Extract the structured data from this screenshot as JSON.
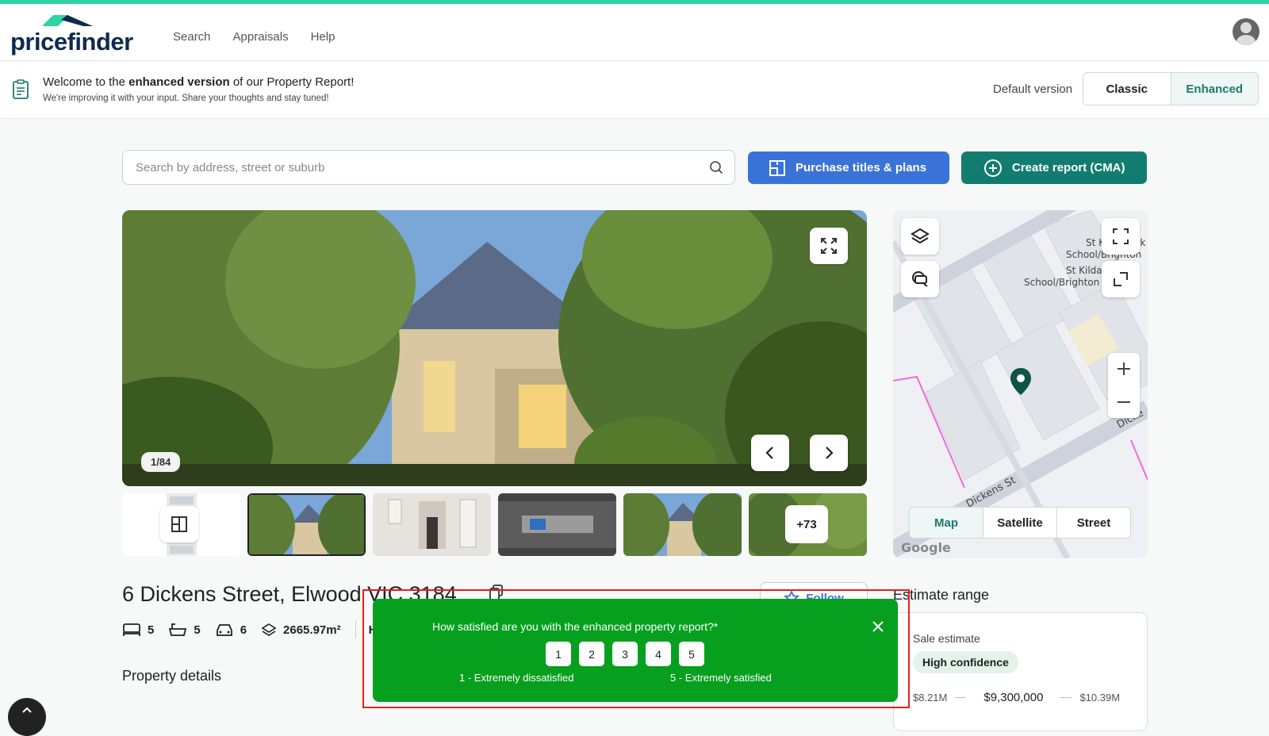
{
  "app": {
    "logo_text": "pricefinder",
    "nav": [
      "Search",
      "Appraisals",
      "Help"
    ]
  },
  "banner": {
    "title_pre": "Welcome to the ",
    "title_bold": "enhanced version",
    "title_post": " of our Property Report!",
    "subtitle": "We're improving it with your input. Share your thoughts and stay tuned!",
    "default_label": "Default version",
    "options": [
      "Classic",
      "Enhanced"
    ],
    "selected": "Enhanced"
  },
  "search": {
    "placeholder": "Search by address, street or suburb",
    "value": ""
  },
  "actions": {
    "purchase_label": "Purchase titles & plans",
    "cma_label": "Create report (CMA)"
  },
  "gallery": {
    "counter": "1/84",
    "more_count": "+73"
  },
  "map": {
    "labels": [
      "St Kilda Park",
      "School/Brighton",
      "St Kilda",
      "School/Brighton",
      "Dickens St",
      "Dicke"
    ],
    "tabs": [
      "Map",
      "Satellite",
      "Street"
    ],
    "active_tab": "Map",
    "attribution": "Google"
  },
  "property": {
    "address": "6 Dickens Street, Elwood VIC 3184",
    "follow_label": "Follow",
    "beds": "5",
    "baths": "5",
    "cars": "6",
    "land": "2665.97m²",
    "type_partial": "Hou",
    "details_title": "Property details"
  },
  "estimate": {
    "title": "Estimate range",
    "label": "Sale estimate",
    "confidence": "High confidence",
    "low": "$8.21M",
    "mid": "$9,300,000",
    "high": "$10.39M"
  },
  "survey": {
    "question": "How satisfied are you with the enhanced property report?*",
    "ratings": [
      "1",
      "2",
      "3",
      "4",
      "5"
    ],
    "low_label": "1 - Extremely dissatisfied",
    "high_label": "5 - Extremely satisfied"
  },
  "colors": {
    "accent": "#2ed3a3",
    "brand_navy": "#0e2a4d",
    "purchase_blue": "#3a73d8",
    "cma_teal": "#127d6f",
    "survey_green": "#06a01e",
    "highlight_red": "#e02020"
  }
}
